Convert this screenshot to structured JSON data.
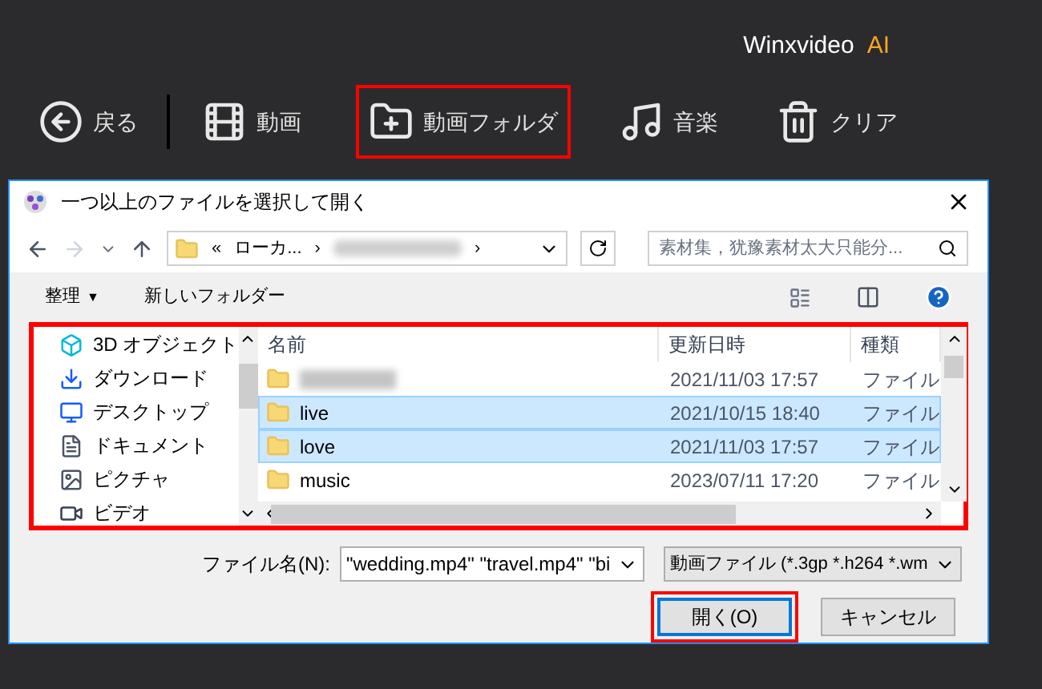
{
  "app": {
    "brand": "Winxvideo",
    "brand_suffix": "AI"
  },
  "toolbar": [
    {
      "kind": "back",
      "label": "戻る",
      "highlighted": false
    },
    {
      "kind": "video",
      "label": "動画",
      "highlighted": false
    },
    {
      "kind": "folder",
      "label": "動画フォルダ",
      "highlighted": true
    },
    {
      "kind": "music",
      "label": "音楽",
      "highlighted": false
    },
    {
      "kind": "clear",
      "label": "クリア",
      "highlighted": false
    }
  ],
  "dialog": {
    "title": "一つ以上のファイルを選択して開く",
    "address": {
      "prefix": "«",
      "crumb": "ローカ...",
      "separator": "›"
    },
    "search": {
      "placeholder": "素材集，犹豫素材太大只能分..."
    },
    "commands": {
      "organize": "整理",
      "organize_caret": "▼",
      "new_folder": "新しいフォルダー"
    },
    "nav": {
      "highlighted": true,
      "items": [
        {
          "kind": "cube",
          "label": "3D オブジェクト"
        },
        {
          "kind": "download",
          "label": "ダウンロード"
        },
        {
          "kind": "desktop",
          "label": "デスクトップ"
        },
        {
          "kind": "document",
          "label": "ドキュメント"
        },
        {
          "kind": "picture",
          "label": "ピクチャ"
        },
        {
          "kind": "video",
          "label": "ビデオ"
        }
      ]
    },
    "columns": [
      "名前",
      "更新日時",
      "種類"
    ],
    "rows": [
      {
        "blurred": true,
        "date": "2021/11/03 17:57",
        "type": "ファイル",
        "selected": false
      },
      {
        "name": "live",
        "blurred": false,
        "date": "2021/10/15 18:40",
        "type": "ファイル",
        "selected": true
      },
      {
        "name": "love",
        "blurred": false,
        "date": "2021/11/03 17:57",
        "type": "ファイル",
        "selected": true
      },
      {
        "name": "music",
        "blurred": false,
        "date": "2023/07/11 17:20",
        "type": "ファイル",
        "selected": false
      }
    ],
    "filename_label": "ファイル名(N):",
    "filename_value": "\"wedding.mp4\" \"travel.mp4\" \"bi",
    "filter": "動画ファイル (*.3gp *.h264 *.wm",
    "buttons": [
      {
        "label": "開く(O)",
        "highlighted": true,
        "default": true
      },
      {
        "label": "キャンセル",
        "highlighted": false,
        "default": false
      }
    ]
  }
}
